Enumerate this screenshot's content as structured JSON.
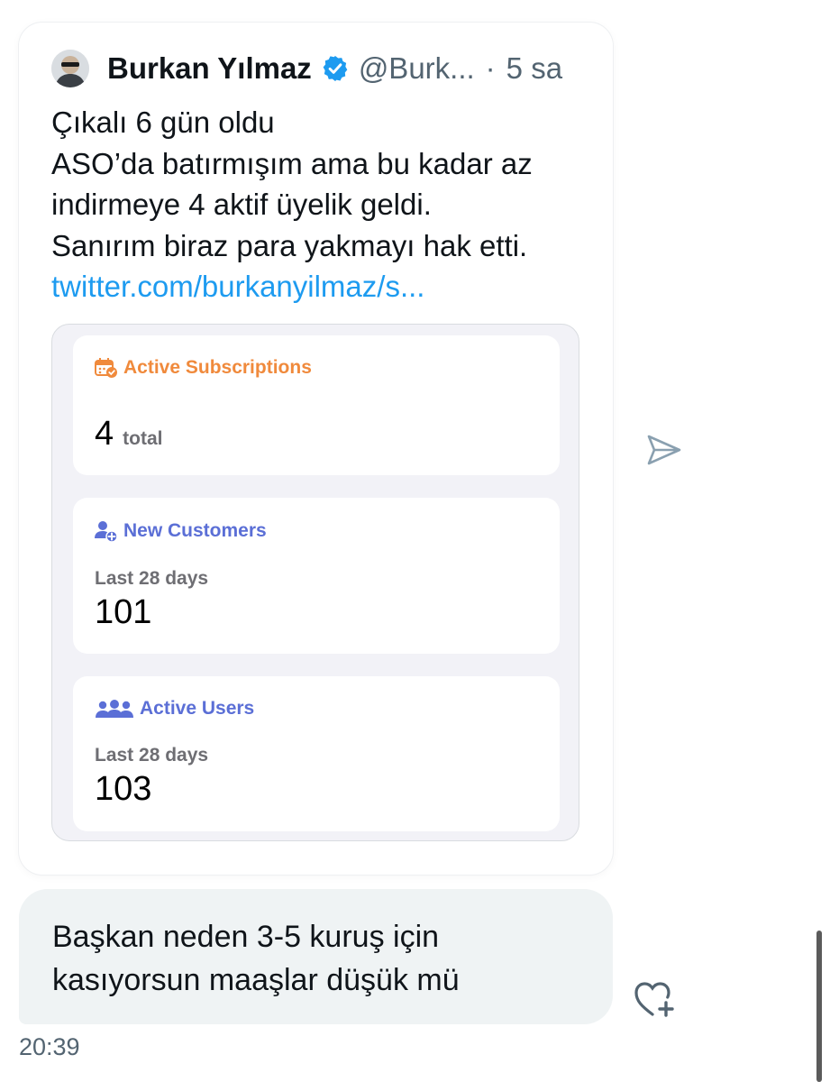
{
  "tweet": {
    "author_name": "Burkan Yılmaz",
    "handle": "@Burk...",
    "separator": "·",
    "time_ago": "5 sa",
    "text_lines": [
      "Çıkalı 6 gün oldu",
      "ASO’da batırmışım ama bu kadar az",
      "indirmeye 4 aktif üyelik geldi.",
      "Sanırım biraz para yakmayı hak etti."
    ],
    "link": "twitter.com/burkanyilmaz/s...",
    "media": {
      "active_subscriptions": {
        "title": "Active Subscriptions",
        "value": "4",
        "unit": "total",
        "color": "#f08a3c"
      },
      "new_customers": {
        "title": "New Customers",
        "subtitle": "Last 28 days",
        "value": "101",
        "color": "#5b6fd6"
      },
      "active_users": {
        "title": "Active Users",
        "subtitle": "Last 28 days",
        "value": "103",
        "color": "#5b6fd6"
      }
    }
  },
  "reply": {
    "lines": [
      "Başkan neden 3-5 kuruş için",
      "kasıyorsun maaşlar düşük mü"
    ],
    "time": "20:39"
  },
  "icons": {
    "verified": "verified-badge-icon",
    "share": "send-icon",
    "react": "heart-plus-icon"
  },
  "colors": {
    "link": "#1d9bf0",
    "verified": "#1d9bf0",
    "bubble": "#eff3f4"
  }
}
